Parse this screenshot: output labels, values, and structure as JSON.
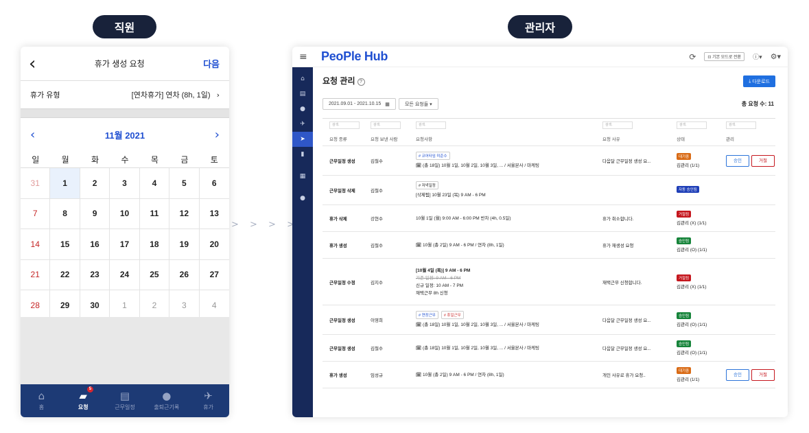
{
  "labels": {
    "employee": "직원",
    "admin": "관리자",
    "arrows": "> > > > > >"
  },
  "mobile": {
    "title": "휴가 생성 요청",
    "next": "다음",
    "leave_type_label": "휴가 유형",
    "leave_type_value": "[연차휴가] 연차 (8h, 1일)",
    "month": "11월 2021",
    "weekdays": [
      "일",
      "월",
      "화",
      "수",
      "목",
      "금",
      "토"
    ],
    "weeks": [
      [
        "31",
        "1",
        "2",
        "3",
        "4",
        "5",
        "6"
      ],
      [
        "7",
        "8",
        "9",
        "10",
        "11",
        "12",
        "13"
      ],
      [
        "14",
        "15",
        "16",
        "17",
        "18",
        "19",
        "20"
      ],
      [
        "21",
        "22",
        "23",
        "24",
        "25",
        "26",
        "27"
      ],
      [
        "28",
        "29",
        "30",
        "1",
        "2",
        "3",
        "4"
      ]
    ],
    "tabs": [
      {
        "label": "홈",
        "icon": "home-icon"
      },
      {
        "label": "요청",
        "icon": "inbox-icon",
        "badge": "5"
      },
      {
        "label": "근무일정",
        "icon": "calendar-icon"
      },
      {
        "label": "출퇴근기록",
        "icon": "clock-icon"
      },
      {
        "label": "휴가",
        "icon": "airplane-icon"
      }
    ]
  },
  "admin": {
    "logo": "PeoPle Hub",
    "view_mode": "기본 모드로 전환",
    "page_title": "요청 관리",
    "help": "?",
    "download": "다운로드",
    "date_range": "2021.09.01 - 2021.10.15",
    "all_requests": "모든 요청들",
    "total": "총 요청 수: 11",
    "filter_placeholder": "검색.",
    "columns": [
      "요청 종류",
      "요청 보낸 사람",
      "요청사항",
      "요청 사유",
      "상태",
      "관리"
    ],
    "approve": "승인",
    "reject": "거절",
    "rows": [
      {
        "type": "근무일정 생성",
        "sender": "김철수",
        "tags": [
          "# 코어타임 미준수"
        ],
        "lines": [
          "🗓 (총 18일) 10월 1일, 10월 2일, 10월 3일, ... / 서울본사 / 마케팅"
        ],
        "reason": "다음달 근무일정 생성 요...",
        "status": "대기중",
        "status_class": "wait",
        "manager": "김관리 (1/1)",
        "actions": true
      },
      {
        "type": "근무일정 삭제",
        "sender": "김철수",
        "tags": [
          "# 저녁일정"
        ],
        "lines": [
          "[삭제됨] 10월 23일 (목) 9 AM - 6 PM"
        ],
        "reason": "",
        "status": "자동 승인됨",
        "status_class": "auto",
        "manager": "",
        "actions": false
      },
      {
        "type": "휴가 삭제",
        "sender": "강현수",
        "tags": [],
        "lines": [
          "10월 1일 (월) 9:00 AM - 6:00 PM 반차 (4h, 0.5일)"
        ],
        "reason": "휴가 취소합니다.",
        "status": "거절됨",
        "status_class": "rej",
        "manager": "김관리 (X) (1/1)",
        "actions": false
      },
      {
        "type": "휴가 생성",
        "sender": "김철수",
        "tags": [],
        "lines": [
          "🗓 10월 (총 2일) 9 AM - 6 PM / 연차 (8h, 1일)"
        ],
        "reason": "휴가 재생성 요청",
        "status": "승인됨",
        "status_class": "ok",
        "manager": "김관리 (O) (1/1)",
        "actions": false
      },
      {
        "type": "근무일정 수정",
        "sender": "김지수",
        "tags": [],
        "lines": [
          "[10월 4일 (목)] 9 AM - 6 PM",
          "기존 일정: 9 AM - 6 PM",
          "신규 일정: 10 AM - 7 PM",
          "재택근무 8h 신청"
        ],
        "reason": "재택근무 신청합니다.",
        "status": "거절됨",
        "status_class": "rej",
        "manager": "김관리 (X) (1/1)",
        "actions": false
      },
      {
        "type": "근무일정 생성",
        "sender": "이영희",
        "tags": [
          "# 연장근무",
          "# 휴일근무"
        ],
        "lines": [
          "🗓 (총 18일) 10월 1일, 10월 2일, 10월 3일, ... / 서울본사 / 마케팅"
        ],
        "reason": "다음달 근무일정 생성 요...",
        "status": "승인됨",
        "status_class": "ok",
        "manager": "김관리 (O) (1/1)",
        "actions": false
      },
      {
        "type": "근무일정 생성",
        "sender": "김철수",
        "tags": [],
        "lines": [
          "🗓 (총 18일) 10월 1일, 10월 2일, 10월 3일, ... / 서울본사 / 마케팅"
        ],
        "reason": "다음달 근무일정 생성 요...",
        "status": "승인됨",
        "status_class": "ok",
        "manager": "김관리 (O) (1/1)",
        "actions": false
      },
      {
        "type": "휴가 생성",
        "sender": "임성규",
        "tags": [],
        "lines": [
          "🗓 10월 (총 2일) 9 AM - 6 PM / 연차 (8h, 1일)"
        ],
        "reason": "개인 사유로 휴가 요청..",
        "status": "대기중",
        "status_class": "wait",
        "manager": "김관리 (1/1)",
        "actions": true
      }
    ]
  }
}
